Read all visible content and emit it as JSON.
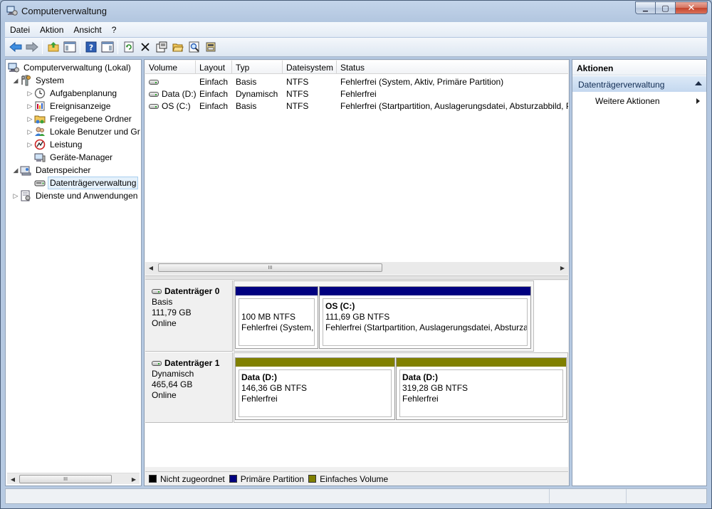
{
  "window": {
    "title": "Computerverwaltung",
    "close_glyph": "✕",
    "minimize_glyph": "▁",
    "maximize_glyph": "▢"
  },
  "menu": [
    "Datei",
    "Aktion",
    "Ansicht",
    "?"
  ],
  "toolbar": {
    "icons": [
      "back-arrow-icon",
      "forward-arrow-icon",
      "up-folder-icon",
      "show-hide-console-tree-icon",
      "help-icon",
      "show-hide-action-pane-icon",
      "refresh-icon",
      "delete-icon",
      "properties-icon",
      "open-icon",
      "search-icon",
      "export-icon"
    ]
  },
  "tree": {
    "root": "Computerverwaltung (Lokal)",
    "system": "System",
    "aufgabenplanung": "Aufgabenplanung",
    "ereignisanzeige": "Ereignisanzeige",
    "freigegebene": "Freigegebene Ordner",
    "lokale": "Lokale Benutzer und Gr",
    "leistung": "Leistung",
    "geraete": "Geräte-Manager",
    "datenspeicher": "Datenspeicher",
    "datentraeger": "Datenträgerverwaltung",
    "dienste": "Dienste und Anwendungen",
    "scroll_thumb_glyph": "III",
    "scroll_left_glyph": "◀",
    "scroll_right_glyph": "▶"
  },
  "volume_list": {
    "columns": [
      "Volume",
      "Layout",
      "Typ",
      "Dateisystem",
      "Status"
    ],
    "rows": [
      {
        "volume": "",
        "layout": "Einfach",
        "typ": "Basis",
        "fs": "NTFS",
        "status": "Fehlerfrei (System, Aktiv, Primäre Partition)"
      },
      {
        "volume": "Data (D:)",
        "layout": "Einfach",
        "typ": "Dynamisch",
        "fs": "NTFS",
        "status": "Fehlerfrei"
      },
      {
        "volume": "OS (C:)",
        "layout": "Einfach",
        "typ": "Basis",
        "fs": "NTFS",
        "status": "Fehlerfrei (Startpartition, Auslagerungsdatei, Absturzabbild, P"
      }
    ]
  },
  "disks": [
    {
      "name": "Datenträger 0",
      "type": "Basis",
      "size": "111,79 GB",
      "state": "Online",
      "partitions": [
        {
          "name": "",
          "size": "100 MB NTFS",
          "status": "Fehlerfrei (System, A"
        },
        {
          "name": "OS  (C:)",
          "size": "111,69 GB NTFS",
          "status": "Fehlerfrei (Startpartition, Auslagerungsdatei, Absturza"
        }
      ]
    },
    {
      "name": "Datenträger 1",
      "type": "Dynamisch",
      "size": "465,64 GB",
      "state": "Online",
      "partitions": [
        {
          "name": "Data  (D:)",
          "size": "146,36 GB NTFS",
          "status": "Fehlerfrei"
        },
        {
          "name": "Data  (D:)",
          "size": "319,28 GB NTFS",
          "status": "Fehlerfrei"
        }
      ]
    }
  ],
  "legend": [
    {
      "label": "Nicht zugeordnet",
      "color": "#000000"
    },
    {
      "label": "Primäre Partition",
      "color": "#000080"
    },
    {
      "label": "Einfaches Volume",
      "color": "#808000"
    }
  ],
  "actions": {
    "title": "Aktionen",
    "section": "Datenträgerverwaltung",
    "item": "Weitere Aktionen"
  },
  "colors": {
    "primary_partition": "#000080",
    "simple_volume": "#808000"
  }
}
